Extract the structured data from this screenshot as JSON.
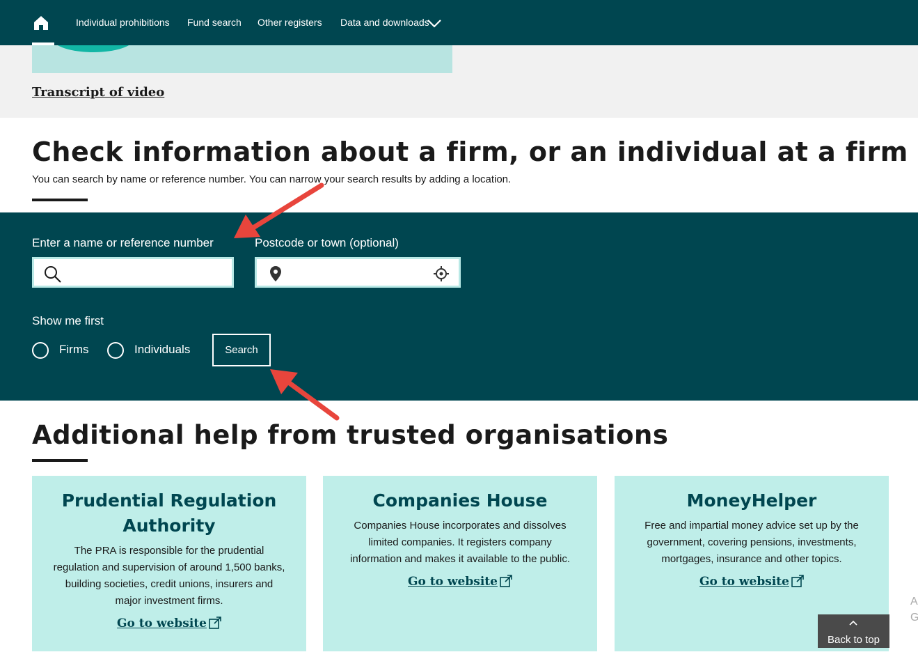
{
  "nav": {
    "home_icon": "home-icon",
    "items": [
      "Individual prohibitions",
      "Fund search",
      "Other registers",
      "Data and downloads"
    ],
    "dropdown_icon": "chevron-down-icon"
  },
  "video": {
    "transcript_link": "Transcript of video"
  },
  "check": {
    "title": "Check information about a firm, or an individual at a firm",
    "intro": "You can search by name or reference number. You can narrow your search results by adding a location."
  },
  "search": {
    "name_label": "Enter a name or reference number",
    "name_value": "",
    "location_label": "Postcode or town (optional)",
    "location_value": "",
    "show_first_label": "Show me first",
    "options": [
      "Firms",
      "Individuals"
    ],
    "button_label": "Search"
  },
  "help": {
    "title": "Additional help from trusted organisations",
    "cards": [
      {
        "title": "Prudential Regulation Authority",
        "text": "The PRA is responsible for the prudential regulation and supervision of around 1,500 banks, building societies, credit unions, insurers and major investment firms.",
        "link": "Go to website"
      },
      {
        "title": "Companies House",
        "text": "Companies House incorporates and dissolves limited companies. It registers company information and makes it available to the public.",
        "link": "Go to website"
      },
      {
        "title": "MoneyHelper",
        "text": "Free and impartial money advice set up by the government, covering pensions, investments, mortgages, insurance and other topics.",
        "link": "Go to website"
      }
    ]
  },
  "back_to_top": "Back to top",
  "colors": {
    "brand_dark_teal": "#004650",
    "card_background": "#bfeee9",
    "input_border": "#b9e9e6",
    "annotation_arrow": "#e8453c"
  }
}
